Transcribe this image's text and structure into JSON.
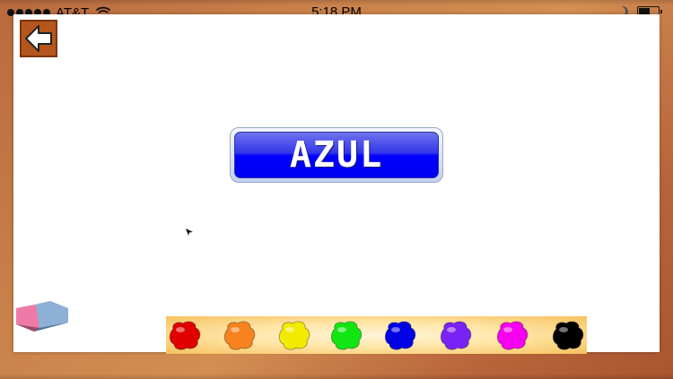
{
  "status_bar": {
    "carrier": "AT&T",
    "time": "5:18 PM",
    "signal_bars": 5,
    "battery_level": 0.6
  },
  "back_button": {
    "icon": "back-arrow-icon",
    "color": "#b5561d"
  },
  "color_label": {
    "text": "AZUL",
    "color": "#0000ff"
  },
  "eraser": {
    "icon": "eraser-icon"
  },
  "palette": {
    "colors": [
      {
        "name": "red",
        "hex": "#e00000"
      },
      {
        "name": "orange",
        "hex": "#f7821e"
      },
      {
        "name": "yellow",
        "hex": "#f2ea00"
      },
      {
        "name": "green",
        "hex": "#12e612"
      },
      {
        "name": "blue",
        "hex": "#0000e6"
      },
      {
        "name": "purple",
        "hex": "#7a22f5"
      },
      {
        "name": "magenta",
        "hex": "#f500f0"
      },
      {
        "name": "black",
        "hex": "#000000"
      }
    ]
  }
}
